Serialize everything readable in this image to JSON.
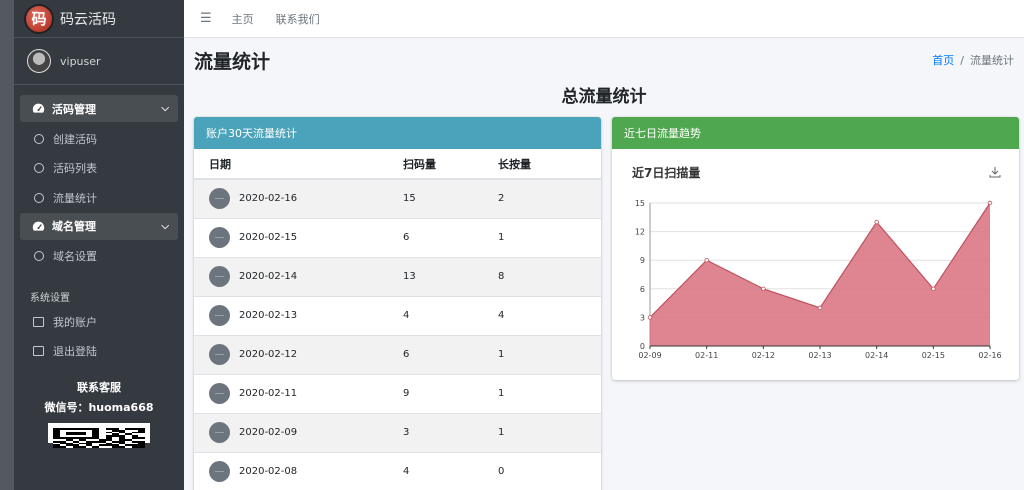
{
  "brand": {
    "logo_char": "码",
    "name": "码云活码"
  },
  "user": {
    "name": "vipuser"
  },
  "sidebar": {
    "groups": [
      {
        "label": "活码管理",
        "items": [
          "创建活码",
          "活码列表",
          "流量统计"
        ]
      },
      {
        "label": "域名管理",
        "items": [
          "域名设置"
        ]
      }
    ],
    "system_header": "系统设置",
    "system_links": [
      "我的账户",
      "退出登陆"
    ],
    "support_title": "联系客服",
    "support_wechat": "微信号：huoma668"
  },
  "topbar": {
    "home": "主页",
    "contact": "联系我们"
  },
  "page": {
    "title": "流量统计",
    "breadcrumb_home": "首页",
    "breadcrumb_current": "流量统计",
    "sep": "/"
  },
  "section_title": "总流量统计",
  "table_card": {
    "title": "账户30天流量统计",
    "columns": [
      "日期",
      "扫码量",
      "长按量"
    ],
    "rows": [
      {
        "date": "2020-02-16",
        "scan": "15",
        "press": "2"
      },
      {
        "date": "2020-02-15",
        "scan": "6",
        "press": "1"
      },
      {
        "date": "2020-02-14",
        "scan": "13",
        "press": "8"
      },
      {
        "date": "2020-02-13",
        "scan": "4",
        "press": "4"
      },
      {
        "date": "2020-02-12",
        "scan": "6",
        "press": "1"
      },
      {
        "date": "2020-02-11",
        "scan": "9",
        "press": "1"
      },
      {
        "date": "2020-02-09",
        "scan": "3",
        "press": "1"
      },
      {
        "date": "2020-02-08",
        "scan": "4",
        "press": "0"
      }
    ]
  },
  "chart_card": {
    "title": "近七日流量趋势"
  },
  "chart_data": {
    "type": "area",
    "title": "近7日扫描量",
    "categories": [
      "02-09",
      "02-11",
      "02-12",
      "02-13",
      "02-14",
      "02-15",
      "02-16"
    ],
    "values": [
      3,
      9,
      6,
      4,
      13,
      6,
      15
    ],
    "ylim": [
      0,
      15
    ],
    "yticks": [
      0,
      3,
      6,
      9,
      12,
      15
    ],
    "grid": true,
    "color": "#d9707e",
    "line_color": "#c0505e"
  }
}
